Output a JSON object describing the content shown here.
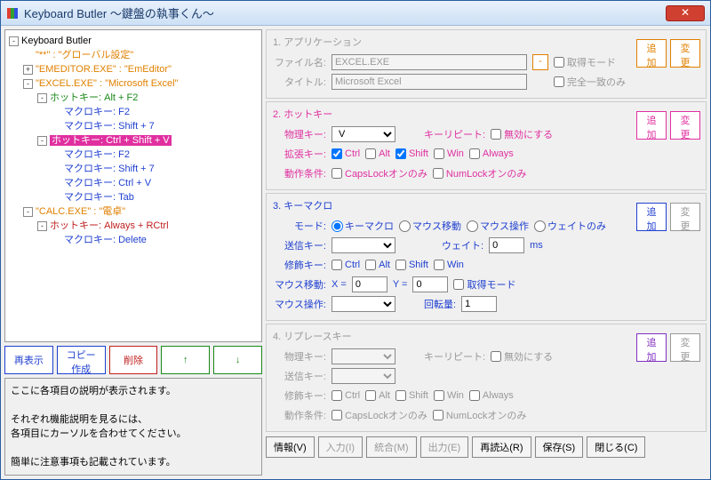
{
  "window": {
    "title": "Keyboard Butler ～鍵盤の執事くん～"
  },
  "tree": [
    {
      "ind": 0,
      "exp": "-",
      "cls": "c-root",
      "text": "Keyboard Butler"
    },
    {
      "ind": 1,
      "exp": "",
      "cls": "c-orange",
      "text": "\"**\" : \"グローバル設定\""
    },
    {
      "ind": 1,
      "exp": "+",
      "cls": "c-orange",
      "text": "\"EMEDITOR.EXE\" : \"EmEditor\""
    },
    {
      "ind": 1,
      "exp": "-",
      "cls": "c-orange",
      "text": "\"EXCEL.EXE\" : \"Microsoft Excel\""
    },
    {
      "ind": 2,
      "exp": "-",
      "cls": "c-green",
      "text": "ホットキー:  Alt + F2"
    },
    {
      "ind": 3,
      "exp": "",
      "cls": "c-blue",
      "text": "マクロキー:  F2"
    },
    {
      "ind": 3,
      "exp": "",
      "cls": "c-blue",
      "text": "マクロキー:  Shift + 7"
    },
    {
      "ind": 2,
      "exp": "-",
      "cls": "c-green",
      "sel": true,
      "text": "ホットキー:  Ctrl + Shift + V"
    },
    {
      "ind": 3,
      "exp": "",
      "cls": "c-blue",
      "text": "マクロキー:  F2"
    },
    {
      "ind": 3,
      "exp": "",
      "cls": "c-blue",
      "text": "マクロキー:  Shift + 7"
    },
    {
      "ind": 3,
      "exp": "",
      "cls": "c-blue",
      "text": "マクロキー:  Ctrl + V"
    },
    {
      "ind": 3,
      "exp": "",
      "cls": "c-blue",
      "text": "マクロキー:  Tab"
    },
    {
      "ind": 1,
      "exp": "-",
      "cls": "c-orange",
      "text": "\"CALC.EXE\" : \"電卓\""
    },
    {
      "ind": 2,
      "exp": "-",
      "cls": "c-red",
      "text": "ホットキー:  Always + RCtrl"
    },
    {
      "ind": 3,
      "exp": "",
      "cls": "c-blue",
      "text": "マクロキー:  Delete"
    }
  ],
  "btns": {
    "redisplay": "再表示",
    "copy": "コピー作成",
    "del": "削除",
    "up": "↑",
    "down": "↓"
  },
  "help": {
    "l1": "ここに各項目の説明が表示されます。",
    "l2": "それぞれ機能説明を見るには、",
    "l3": "各項目にカーソルを合わせてください。",
    "l4": "簡単に注意事項も記載されています。"
  },
  "app": {
    "title": "1. アプリケーション",
    "fname": "ファイル名:",
    "fval": "EXCEL.EXE",
    "tname": "タイトル:",
    "tval": "Microsoft Excel",
    "getmode": "取得モード",
    "exact": "完全一致のみ",
    "add": "追加",
    "change": "変更"
  },
  "hot": {
    "title": "2. ホットキー",
    "phys": "物理キー:",
    "physval": "V",
    "repeat": "キーリピート:",
    "disable": "無効にする",
    "ext": "拡張キー:",
    "ctrl": "Ctrl",
    "alt": "Alt",
    "shift": "Shift",
    "win": "Win",
    "always": "Always",
    "cond": "動作条件:",
    "caps": "CapsLockオンのみ",
    "num": "NumLockオンのみ",
    "add": "追加",
    "change": "変更"
  },
  "macro": {
    "title": "3. キーマクロ",
    "mode": "モード:",
    "m1": "キーマクロ",
    "m2": "マウス移動",
    "m3": "マウス操作",
    "m4": "ウェイトのみ",
    "send": "送信キー:",
    "wait": "ウェイト:",
    "waitval": "0",
    "ms": "ms",
    "mod": "修飾キー:",
    "ctrl": "Ctrl",
    "alt": "Alt",
    "shift": "Shift",
    "win": "Win",
    "mmove": "マウス移動:",
    "x": "X =",
    "xval": "0",
    "y": "Y =",
    "yval": "0",
    "getmode": "取得モード",
    "mop": "マウス操作:",
    "rot": "回転量:",
    "rotval": "1",
    "add": "追加",
    "change": "変更"
  },
  "replace": {
    "title": "4. リプレースキー",
    "phys": "物理キー:",
    "repeat": "キーリピート:",
    "disable": "無効にする",
    "send": "送信キー:",
    "mod": "修飾キー:",
    "ctrl": "Ctrl",
    "alt": "Alt",
    "shift": "Shift",
    "win": "Win",
    "always": "Always",
    "cond": "動作条件:",
    "caps": "CapsLockオンのみ",
    "num": "NumLockオンのみ",
    "add": "追加",
    "change": "変更"
  },
  "bottom": {
    "info": "情報(V)",
    "input": "入力(I)",
    "merge": "統合(M)",
    "output": "出力(E)",
    "reload": "再読込(R)",
    "save": "保存(S)",
    "close": "閉じる(C)"
  }
}
